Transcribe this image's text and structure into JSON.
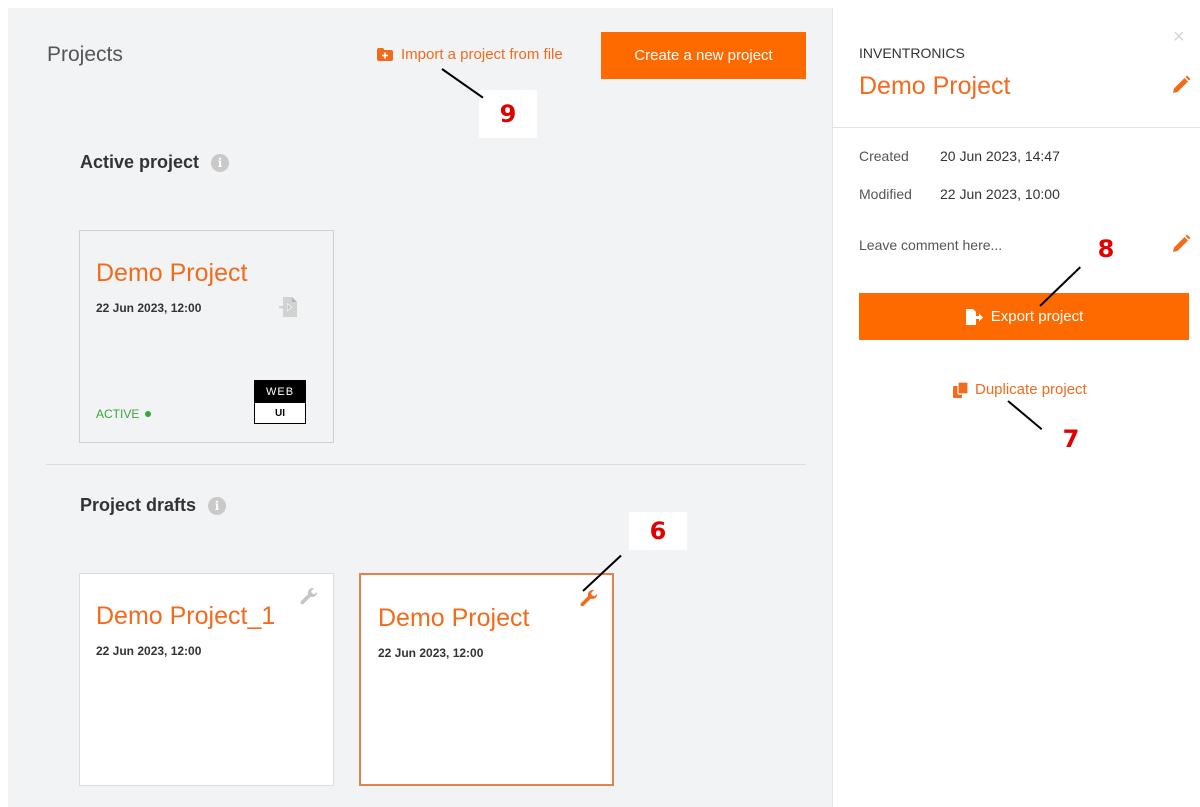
{
  "header": {
    "title": "Projects",
    "import_label": "Import a project from file",
    "create_label": "Create a new project"
  },
  "active_section": {
    "title": "Active project",
    "info_glyph": "i",
    "card": {
      "title": "Demo Project",
      "date": "22 Jun 2023, 12:00",
      "status": "ACTIVE",
      "badge_top": "WEB",
      "badge_bottom": "UI"
    }
  },
  "drafts_section": {
    "title": "Project drafts",
    "info_glyph": "i",
    "cards": [
      {
        "title": "Demo Project_1",
        "date": "22 Jun 2023, 12:00"
      },
      {
        "title": "Demo Project",
        "date": "22 Jun 2023, 12:00"
      }
    ]
  },
  "panel": {
    "brand": "INVENTRONICS",
    "title": "Demo Project",
    "close_glyph": "×",
    "created_label": "Created",
    "created_value": "20 Jun 2023, 14:47",
    "modified_label": "Modified",
    "modified_value": "22 Jun 2023, 10:00",
    "comment_placeholder": "Leave comment here...",
    "export_label": "Export project",
    "duplicate_label": "Duplicate project"
  },
  "callouts": {
    "c6": "6",
    "c7": "7",
    "c8": "8",
    "c9": "9"
  },
  "colors": {
    "accent": "#ff6a00",
    "active_status": "#3aa63a",
    "callout": "#e00000"
  }
}
